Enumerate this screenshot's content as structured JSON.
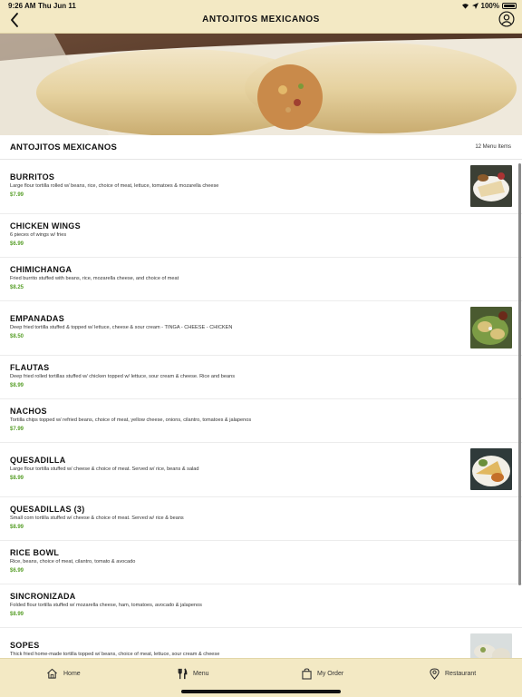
{
  "status_bar": {
    "time": "9:26 AM",
    "date": "Thu Jun 11",
    "battery": "100%"
  },
  "header": {
    "title": "ANTOJITOS MEXICANOS"
  },
  "section": {
    "title": "ANTOJITOS MEXICANOS",
    "count": "12 Menu Items"
  },
  "menu_items": [
    {
      "name": "BURRITOS",
      "desc": "Large flour tortilla rolled w/ beans, rice, choice of meat, lettuce, tomatoes & mozarella cheese",
      "price": "$7.99",
      "has_image": true
    },
    {
      "name": "CHICKEN WINGS",
      "desc": "6 pieces of wings w/ fries",
      "price": "$6.99",
      "has_image": false
    },
    {
      "name": "CHIMICHANGA",
      "desc": "Fried burrito stuffed with beans, rice, mozarella cheese, and choice of meat",
      "price": "$8.25",
      "has_image": false
    },
    {
      "name": "EMPANADAS",
      "desc": "Deep fried tortilla stuffed & topped w/ lettuce, cheese & sour cream - TINGA - CHEESE - CHICKEN",
      "price": "$8.50",
      "has_image": true
    },
    {
      "name": "FLAUTAS",
      "desc": "Deep fried rolled tortillas stuffed w/ chicken topped w/ lettuce, sour cream & cheese. Rice and beans",
      "price": "$8.99",
      "has_image": false
    },
    {
      "name": "NACHOS",
      "desc": "Tortilla chips topped w/ refried beans, choice of meat, yellow cheese, onions, cilantro, tomatoes & jalapenos",
      "price": "$7.99",
      "has_image": false
    },
    {
      "name": "QUESADILLA",
      "desc": "Large flour tortilla stuffed w/ cheese & choice of meat. Served w/ rice, beans & salad",
      "price": "$8.99",
      "has_image": true
    },
    {
      "name": "QUESADILLAS (3)",
      "desc": "Small corn tortilla stuffed w/ cheese & choice of meat. Served w/ rice & beans",
      "price": "$8.99",
      "has_image": false
    },
    {
      "name": "RICE BOWL",
      "desc": "Rice, beans, choice of meat, cilantro, tomato & avocado",
      "price": "$6.99",
      "has_image": false
    },
    {
      "name": "SINCRONIZADA",
      "desc": "Folded flour tortilla stuffed w/ mozarella cheese, ham, tomatoes, avocado & jalapenos",
      "price": "$8.99",
      "has_image": false
    },
    {
      "name": "SOPES",
      "desc": "Thick fried home-made tortilla topped w/ beans, choice of meat, lettuce, sour cream & cheese",
      "price": "",
      "has_image": true
    }
  ],
  "tabbar": {
    "home": "Home",
    "menu": "Menu",
    "order": "My Order",
    "restaurant": "Restaurant"
  },
  "colors": {
    "header_bg": "#f3e9c4",
    "price_green": "#5aa02c"
  }
}
